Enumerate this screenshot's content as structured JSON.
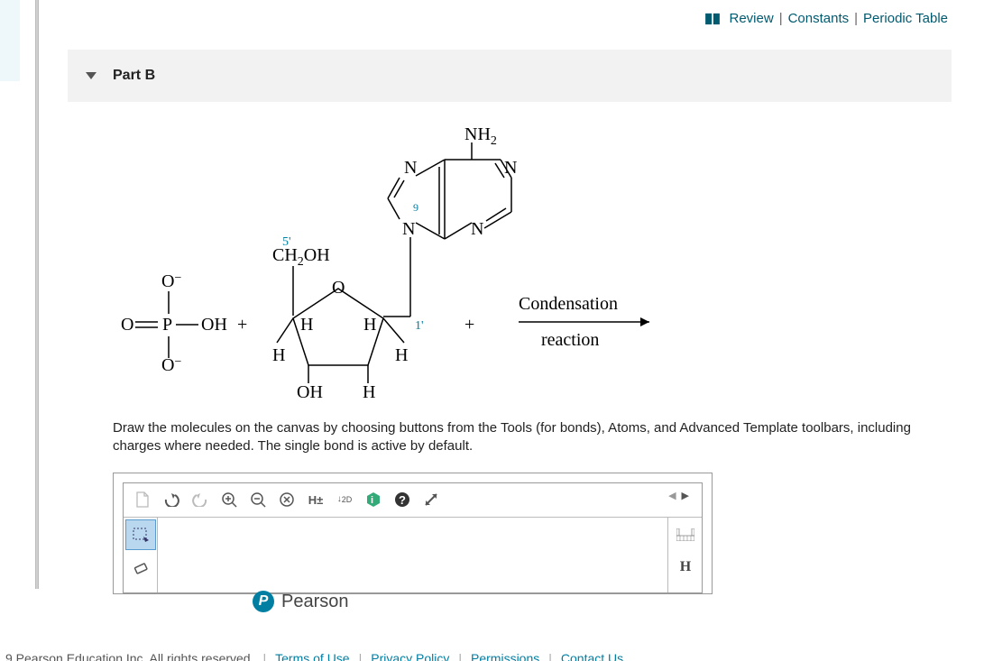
{
  "top_links": {
    "review": "Review",
    "constants": "Constants",
    "periodic": "Periodic Table"
  },
  "part": {
    "label": "Part B"
  },
  "reaction": {
    "phosphate": {
      "o_minus_top": "O",
      "o_minus_bot": "O",
      "o_double": "O",
      "p": "P",
      "oh": "OH"
    },
    "plus1": "+",
    "sugar": {
      "ch2oh": "CH",
      "ch2oh_sub": "2",
      "ch2oh_oh": "OH",
      "five_prime": "5'",
      "ring_o": "O",
      "h1": "H",
      "h2": "H",
      "h3": "H",
      "h4": "H",
      "oh": "OH",
      "h_bottom": "H",
      "one_prime": "1'"
    },
    "base": {
      "n1": "N",
      "n2": "N",
      "n3": "N",
      "n4": "N",
      "nh": "NH",
      "nh_sub": "2",
      "nine": "9"
    },
    "plus2": "+",
    "arrow": {
      "top": "Condensation",
      "bottom": "reaction"
    }
  },
  "instruction": "Draw the molecules on the canvas by choosing buttons from the Tools (for bonds), Atoms, and Advanced Template toolbars, including charges where needed. The single bond is active by default.",
  "drawer": {
    "toolbar": {
      "hplus": "H±",
      "two_d": "2D"
    },
    "right": {
      "h": "H"
    }
  },
  "brand": {
    "p": "P",
    "name": "Pearson"
  },
  "footer": {
    "copyright_partial": "9 Pearson Education Inc. All rights reserved.",
    "terms": "Terms of Use",
    "privacy": "Privacy Policy",
    "permissions": "Permissions",
    "contact": "Contact Us"
  }
}
